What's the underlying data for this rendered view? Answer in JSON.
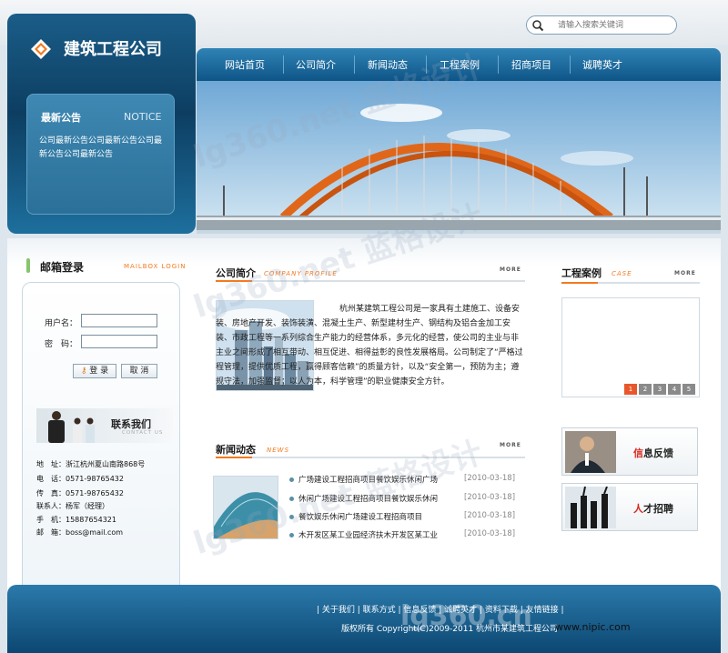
{
  "header": {
    "company_name": "建筑工程公司",
    "search_placeholder": "请输入搜索关键词"
  },
  "notice": {
    "title_cn": "最新公告",
    "title_en": "NOTICE",
    "body": "公司最新公告公司最新公告公司最新公告公司最新公告"
  },
  "nav": {
    "items": [
      "网站首页",
      "公司简介",
      "新闻动态",
      "工程案例",
      "招商项目",
      "诚聘英才"
    ]
  },
  "mailbox": {
    "title_cn": "邮箱登录",
    "title_en": "MAILBOX LOGIN",
    "username_label": "用户名：",
    "password_label": "密　码：",
    "login_button": "登 录",
    "cancel_button": "取 消"
  },
  "contact": {
    "title_cn": "联系我们",
    "title_en": "CONTACT US",
    "lines": [
      "地　址：浙江杭州夏山南路868号",
      "电　话：0571-98765432",
      "传　真：0571-98765432",
      "联系人：杨军（经理）",
      "手　机：15887654321",
      "邮　箱：boss@mail.com"
    ]
  },
  "about": {
    "title_cn": "公司简介",
    "title_en": "COMPANY PROFILE",
    "more": "MORE",
    "text": "杭州某建筑工程公司是一家具有土建施工、设备安装、房地产开发、装饰装潢、混凝土生产、新型建材生产、钢结构及铝合金加工安装、市政工程等一系列综合生产能力的经营体系，多元化的经营，使公司的主业与非主业之间形成了相互带动、相互促进、相得益彰的良性发展格局。公司制定了“严格过程管理，提供优质工程，赢得顾客信赖”的质量方针，以及“安全第一，预防为主；遵规守法，加强监督；以人为本，科学管理”的职业健康安全方针。"
  },
  "news": {
    "title_cn": "新闻动态",
    "title_en": "NEWS",
    "more": "MORE",
    "items": [
      {
        "title": "广场建设工程招商项目餐饮娱乐休闲广场",
        "date": "[2010-03-18]"
      },
      {
        "title": "休闲广场建设工程招商项目餐饮娱乐休闲",
        "date": "[2010-03-18]"
      },
      {
        "title": "餐饮娱乐休闲广场建设工程招商项目",
        "date": "[2010-03-18]"
      },
      {
        "title": "木开发区某工业园经济扶木开发区某工业",
        "date": "[2010-03-18]"
      }
    ]
  },
  "cases": {
    "title_cn": "工程案例",
    "title_en": "CASE",
    "more": "MORE",
    "pages": [
      "1",
      "2",
      "3",
      "4",
      "5"
    ]
  },
  "side_links": [
    {
      "accent": "信",
      "rest": "息反馈"
    },
    {
      "accent": "人",
      "rest": "才招聘"
    }
  ],
  "footer": {
    "links": "|  关于我们  |  联系方式  |  信息反馈  |  诚聘英才  |  资料下载  |  友情链接  |",
    "copyright": "版权所有 Copyright(C)2009-2011 杭州市某建筑工程公司"
  },
  "watermark": {
    "text": "lg360.net 蓝格设计",
    "site": "lg360.cn",
    "trade": "www.nipic.com"
  },
  "colors": {
    "accent": "#f37a1f",
    "brand_blue": "#0f5587"
  }
}
